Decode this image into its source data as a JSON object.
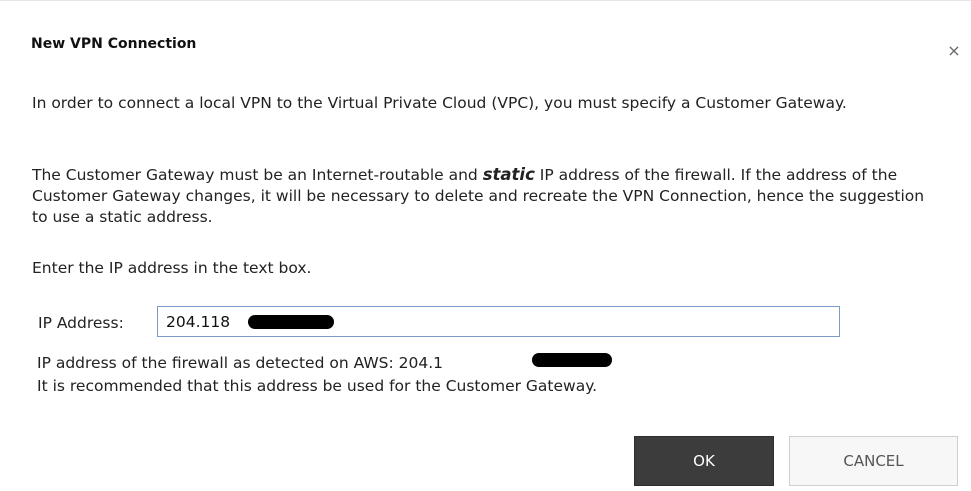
{
  "dialog": {
    "title": "New VPN Connection",
    "close_glyph": "×"
  },
  "body": {
    "paragraph1": "In order to connect a local VPN to the Virtual Private Cloud (VPC), you must specify a Customer Gateway.",
    "paragraph2_before": "The Customer Gateway must be an Internet-routable and ",
    "paragraph2_emphasis": "static",
    "paragraph2_after": " IP address of the firewall. If the address of the Customer Gateway changes, it will be necessary to delete and recreate the VPN Connection, hence the suggestion to use a static address.",
    "paragraph3": "Enter the IP address in the text box."
  },
  "form": {
    "ip_label": "IP Address:",
    "ip_value": "204.118"
  },
  "hints": {
    "detected_text": "IP address of the firewall as detected on AWS: 204.1",
    "recommend_text": "It is recommended that this address be used for the Customer Gateway."
  },
  "buttons": {
    "ok_label": "OK",
    "cancel_label": "CANCEL"
  },
  "colors": {
    "ok_background": "#3c3c3c",
    "input_border": "#7a9cc6"
  }
}
